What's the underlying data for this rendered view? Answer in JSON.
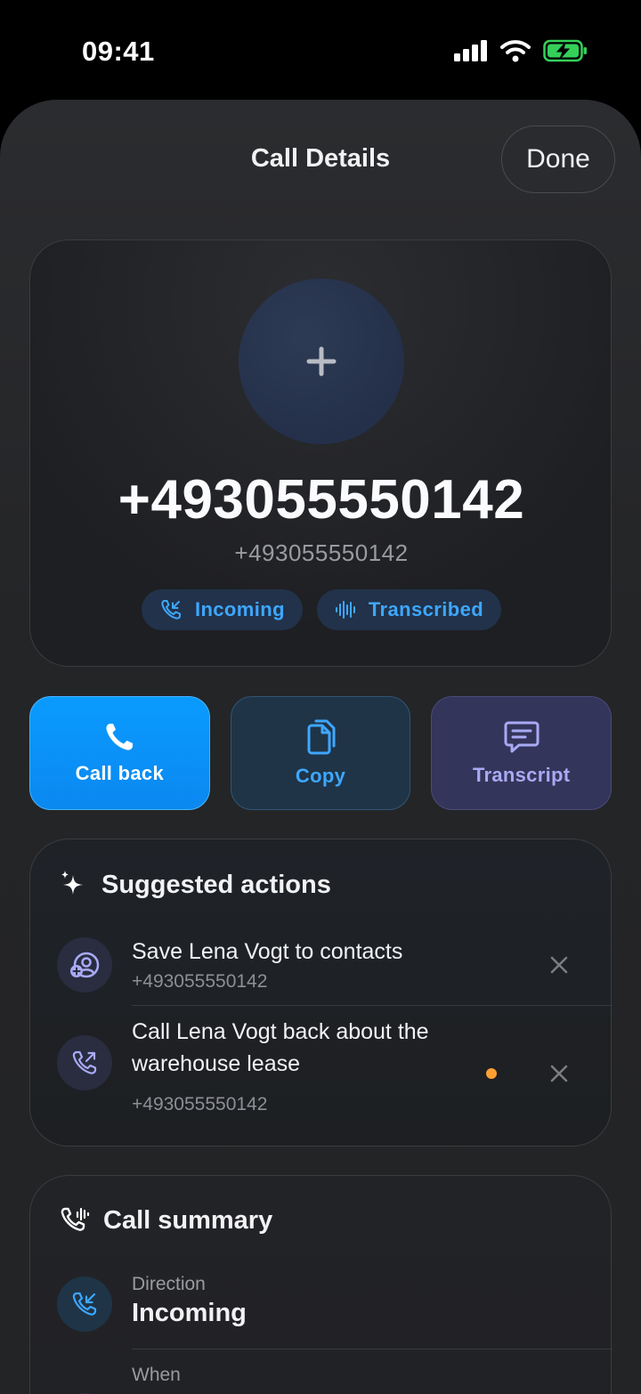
{
  "status_bar": {
    "time": "09:41"
  },
  "sheet": {
    "title": "Call Details",
    "done_label": "Done"
  },
  "caller": {
    "number": "+493055550142",
    "sub_number": "+493055550142",
    "chips": [
      {
        "label": "Incoming",
        "icon": "incoming-call-icon"
      },
      {
        "label": "Transcribed",
        "icon": "waveform-icon"
      }
    ]
  },
  "actions": [
    {
      "label": "Call back",
      "icon": "phone-icon"
    },
    {
      "label": "Copy",
      "icon": "copy-icon"
    },
    {
      "label": "Transcript",
      "icon": "chat-bubble-icon"
    }
  ],
  "suggested": {
    "title": "Suggested actions",
    "items": [
      {
        "title": "Save Lena Vogt to contacts",
        "subtitle": "+493055550142",
        "icon": "add-contact-icon"
      },
      {
        "title": "Call Lena Vogt back about the warehouse lease",
        "subtitle": "+493055550142",
        "icon": "outgoing-call-icon"
      }
    ]
  },
  "summary": {
    "title": "Call summary",
    "rows": [
      {
        "label": "Direction",
        "value": "Incoming",
        "icon": "incoming-call-icon"
      },
      {
        "label": "When",
        "value": "",
        "icon": "calendar-icon"
      }
    ]
  },
  "colors": {
    "accent": "#0a9bff",
    "indicator": "#ffa033"
  }
}
